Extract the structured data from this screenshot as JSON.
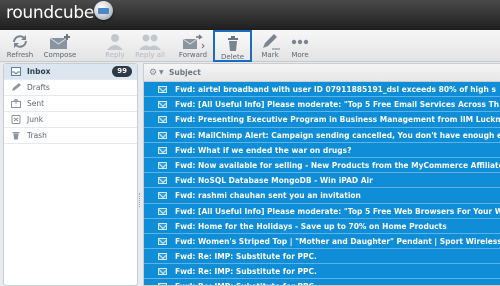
{
  "app": {
    "logo_text": "roundcube"
  },
  "toolbar": {
    "refresh": "Refresh",
    "compose": "Compose",
    "reply": "Reply",
    "reply_all": "Reply all",
    "forward": "Forward",
    "delete": "Delete",
    "mark": "Mark",
    "more": "More"
  },
  "sidebar": {
    "folders": [
      {
        "label": "Inbox",
        "count": "99"
      },
      {
        "label": "Drafts"
      },
      {
        "label": "Sent"
      },
      {
        "label": "Junk"
      },
      {
        "label": "Trash"
      }
    ]
  },
  "list": {
    "header": "Subject",
    "messages": [
      "Fwd: airtel broadband with user ID 07911885191_dsl exceeds 80% of high s",
      "Fwd: [All Useful Info] Please moderate: \"Top 5 Free Email Services Across Th",
      "Fwd: Presenting Executive Program in Business Management from IIM Lucknow",
      "Fwd: MailChimp Alert: Campaign sending cancelled, You don't have enough em",
      "Fwd: What if we ended the war on drugs?",
      "Fwd: Now available for selling - New Products from the MyCommerce Affiliate",
      "Fwd: NoSQL Database MongoDB - Win iPAD Air",
      "Fwd: rashmi chauhan sent you an invitation",
      "Fwd: [All Useful Info] Please moderate: \"Top 5 Free Web Browsers For Your W",
      "Fwd: Home for the Holidays - Save up to 70% on Home Products",
      "Fwd: Women's Striped Top | \"Mother and Daughter\" Pendant | Sport Wireless",
      "Fwd: Re: IMP: Substitute for PPC.",
      "Fwd: Re: IMP: Substitute for PPC.",
      "Fwd: Re: IMP: Substitute for PPC."
    ]
  },
  "colors": {
    "selected_row": "#0f8dd6",
    "header_bg": "#2a2a2a",
    "highlight_border": "#1d6bbd"
  }
}
